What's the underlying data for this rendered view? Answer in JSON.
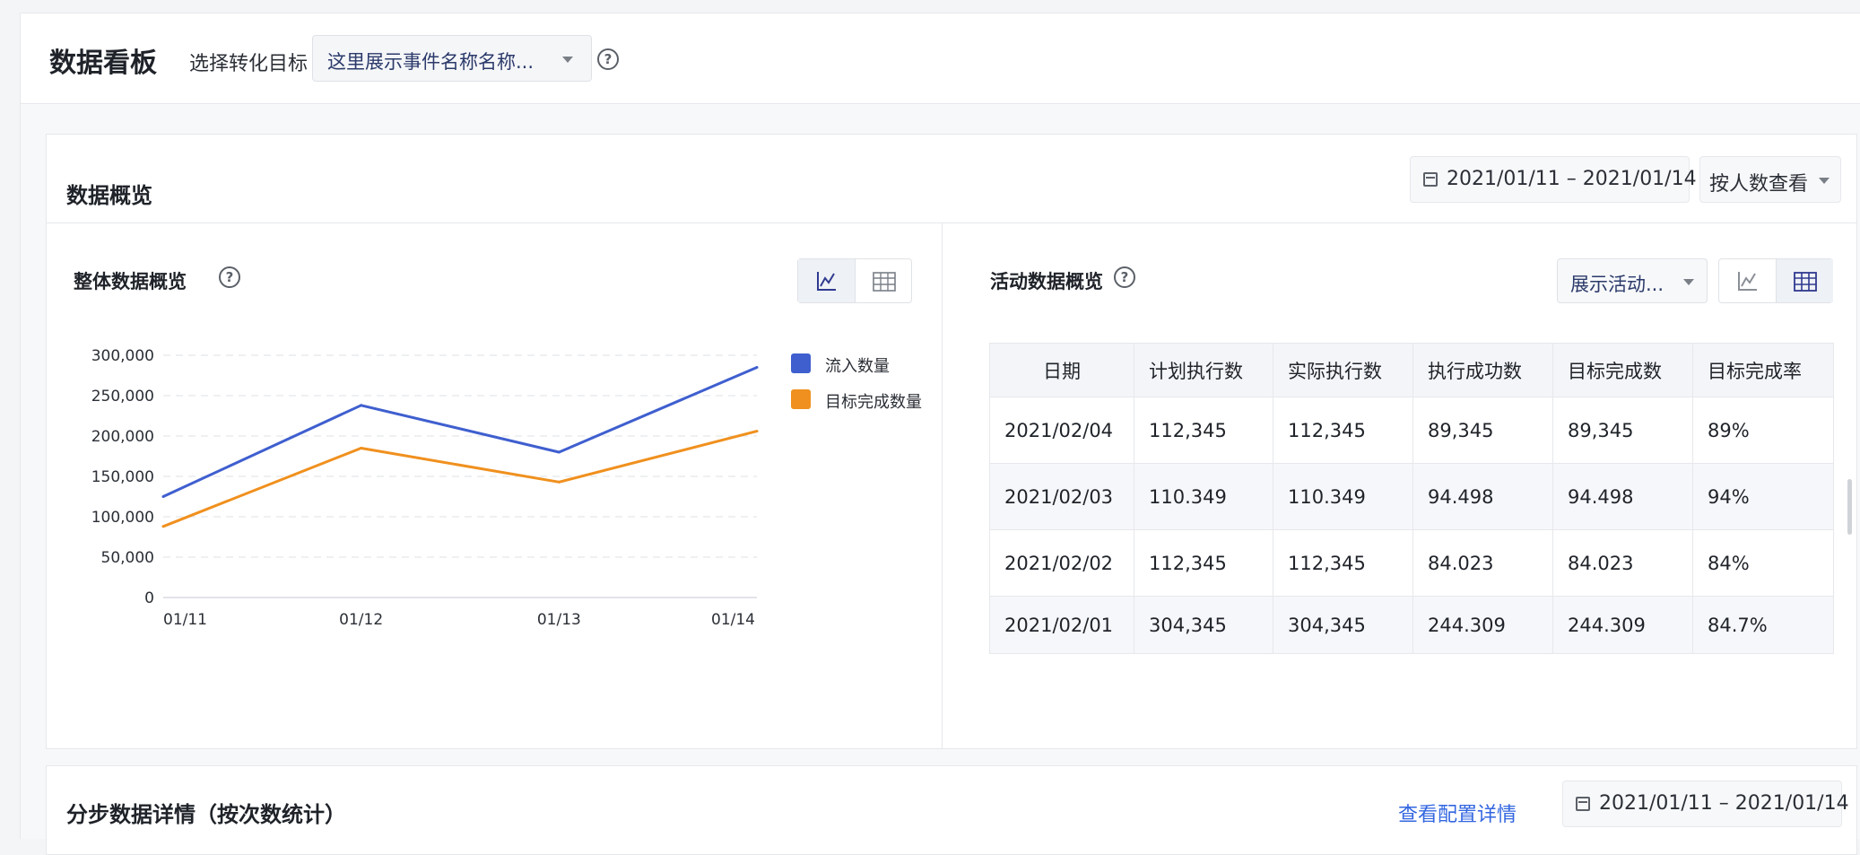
{
  "header": {
    "title": "数据看板",
    "target_label": "选择转化目标",
    "target_select_value": "这里展示事件名称名称...",
    "help": "?"
  },
  "overview": {
    "title": "数据概览",
    "date_range": "2021/01/11 – 2021/01/14",
    "view_select": "按人数查看"
  },
  "left_panel": {
    "title": "整体数据概览",
    "help": "?"
  },
  "right_panel": {
    "title": "活动数据概览",
    "help": "?",
    "activity_select": "展示活动..."
  },
  "colors": {
    "series_blue": "#3f5fcf",
    "series_orange": "#f0901e",
    "link_blue": "#3366e0"
  },
  "chart_data": {
    "type": "line",
    "x": [
      "01/11",
      "01/12",
      "01/13",
      "01/14"
    ],
    "ylim": [
      0,
      300000
    ],
    "yticks": [
      0,
      50000,
      100000,
      150000,
      200000,
      250000,
      300000
    ],
    "ytick_labels": [
      "0",
      "50,000",
      "100,000",
      "150,000",
      "200,000",
      "250,000",
      "300,000"
    ],
    "grid": true,
    "legend_position": "right",
    "series": [
      {
        "name": "流入数量",
        "values": [
          125000,
          238000,
          180000,
          285000
        ],
        "color": "#3f5fcf"
      },
      {
        "name": "目标完成数量",
        "values": [
          88000,
          185000,
          143000,
          206000
        ],
        "color": "#f0901e"
      }
    ]
  },
  "table": {
    "headers": [
      "日期",
      "计划执行数",
      "实际执行数",
      "执行成功数",
      "目标完成数",
      "目标完成率"
    ],
    "rows": [
      [
        "2021/02/04",
        "112,345",
        "112,345",
        "89,345",
        "89,345",
        "89%"
      ],
      [
        "2021/02/03",
        "110.349",
        "110.349",
        "94.498",
        "94.498",
        "94%"
      ],
      [
        "2021/02/02",
        "112,345",
        "112,345",
        "84.023",
        "84.023",
        "84%"
      ],
      [
        "2021/02/01",
        "304,345",
        "304,345",
        "244.309",
        "244.309",
        "84.7%"
      ]
    ]
  },
  "steps_card": {
    "title": "分步数据详情（按次数统计）",
    "config_link": "查看配置详情",
    "date_range": "2021/01/11 – 2021/01/14"
  }
}
